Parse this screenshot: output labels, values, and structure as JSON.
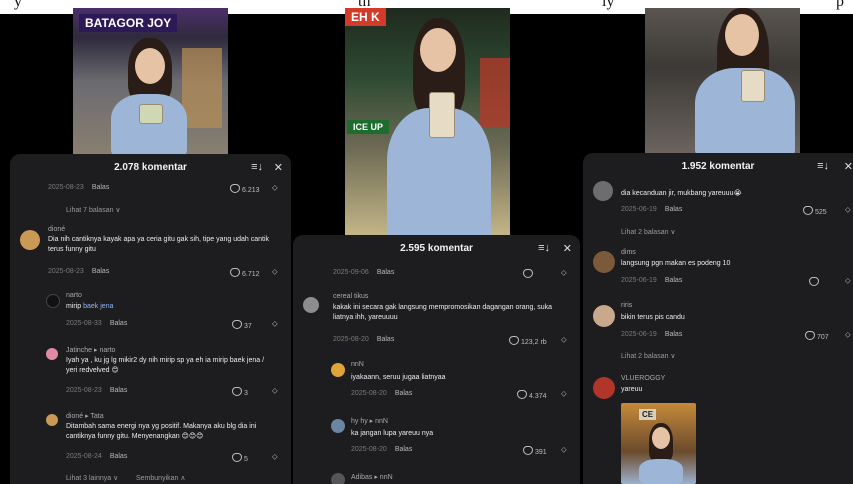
{
  "caption_fragments": [
    "y",
    "th",
    "ly",
    "p"
  ],
  "photo1": {
    "sign": "BATAGOR JOY"
  },
  "photo2": {
    "sign": "EH K",
    "sign2": "ICE UP"
  },
  "photo3": {
    "sign": "CE"
  },
  "panel_left": {
    "title": "2.078 komentar",
    "top_meta": {
      "date": "2025-08-23",
      "reply": "Balas",
      "likes": "6.213"
    },
    "view_replies": "Lihat 7 balasan ∨",
    "comments": [
      {
        "user": "dioné",
        "text": "Dia nih cantiknya kayak apa ya ceria gitu gak sih, tipe yang udah cantik terus funny gitu",
        "date": "2025-08-23",
        "reply": "Balas",
        "likes": "6.712"
      },
      {
        "user": "narto",
        "text_prefix": "mirip ",
        "text_link": "baek jena",
        "date": "2025-08-33",
        "reply": "Balas",
        "likes": "37"
      },
      {
        "user": "Jatinche ▸ narto",
        "text": "Iyah ya , ku jg lg mikir2 dy nih mirip sp ya eh ia mirip baek jena / yeri redvelved 😊",
        "date": "2025-08-23",
        "reply": "Balas",
        "likes": "3"
      },
      {
        "user": "dioné ▸ Tata",
        "text": "Ditambah sama energi nya yg positif. Makanya aku blg dia ini cantiknya funny gitu. Menyenangkan 😊😊😊",
        "date": "2025-08-24",
        "reply": "Balas",
        "likes": "5"
      }
    ],
    "footer": {
      "more": "Lihat 3 lainnya ∨",
      "hide": "Sembunyikan ∧"
    }
  },
  "panel_mid": {
    "title": "2.595 komentar",
    "top_meta": {
      "date": "2025-09-06",
      "reply": "Balas"
    },
    "comments": [
      {
        "user": "cereal tikus",
        "text": "kakak ini secara gak langsung mempromosikan dagangan orang, suka liatnya ihh, yareuuuu",
        "date": "2025-08-20",
        "reply": "Balas",
        "likes": "123,2 rb"
      },
      {
        "user": "nnN",
        "text": "iyakaann, seruu jugaa liatnyaa",
        "date": "2025-08-20",
        "reply": "Balas",
        "likes": "4.374"
      },
      {
        "user": "hy hy ▸ nnN",
        "text": "ka jangan lupa yareuu nya",
        "date": "2025-08-20",
        "reply": "Balas",
        "likes": "391"
      },
      {
        "user": "Adibas ▸ nnN"
      }
    ]
  },
  "panel_right": {
    "title": "1.952 komentar",
    "comments": [
      {
        "user": "",
        "text": "dia kecanduan jir, mukbang yareuuu😭",
        "date": "2025-06-19",
        "reply": "Balas",
        "likes": "525"
      },
      {
        "user": "dims",
        "text": "langsung pgn makan es podeng 10",
        "date": "2025-06-19",
        "reply": "Balas",
        "likes": ""
      },
      {
        "user": "riris",
        "text": "bikin terus pis candu",
        "date": "2025-06-19",
        "reply": "Balas",
        "likes": "707"
      },
      {
        "user": "VLUEROGGY",
        "text": "yareuu"
      }
    ],
    "view_replies_1": "Lihat 2 balasan ∨",
    "view_replies_2": "Lihat 2 balasan ∨"
  },
  "icons": {
    "sort": "sort-icon",
    "close": "close-icon",
    "heart": "heart-icon",
    "dislike": "dislike-icon"
  },
  "colors": {
    "panel": "#1d1d1f",
    "link": "#8fb4ff"
  }
}
